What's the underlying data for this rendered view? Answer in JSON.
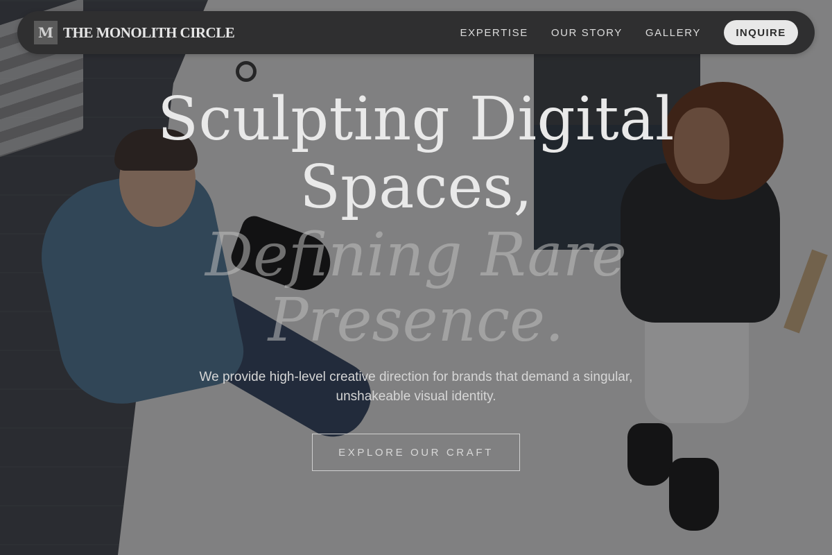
{
  "header": {
    "brand_initial": "M",
    "brand_name": "THE MONOLITH CIRCLE",
    "nav": [
      "EXPERTISE",
      "OUR STORY",
      "GALLERY"
    ],
    "cta_label": "INQUIRE"
  },
  "hero": {
    "headline_line1": "Sculpting Digital",
    "headline_line2": "Spaces,",
    "headline_line3": "Defining Rare",
    "headline_line4": "Presence.",
    "subtitle": "We provide high-level creative direction for brands that demand a singular, unshakeable visual identity.",
    "button_label": "EXPLORE OUR CRAFT"
  },
  "colors": {
    "nav_bg": "#2f2f30",
    "nav_text": "#dcdcdc",
    "accent_button_bg": "#e8e8e8",
    "overlay": "rgba(20,20,22,0.45)"
  },
  "icons": [
    "monogram-logo-icon"
  ]
}
